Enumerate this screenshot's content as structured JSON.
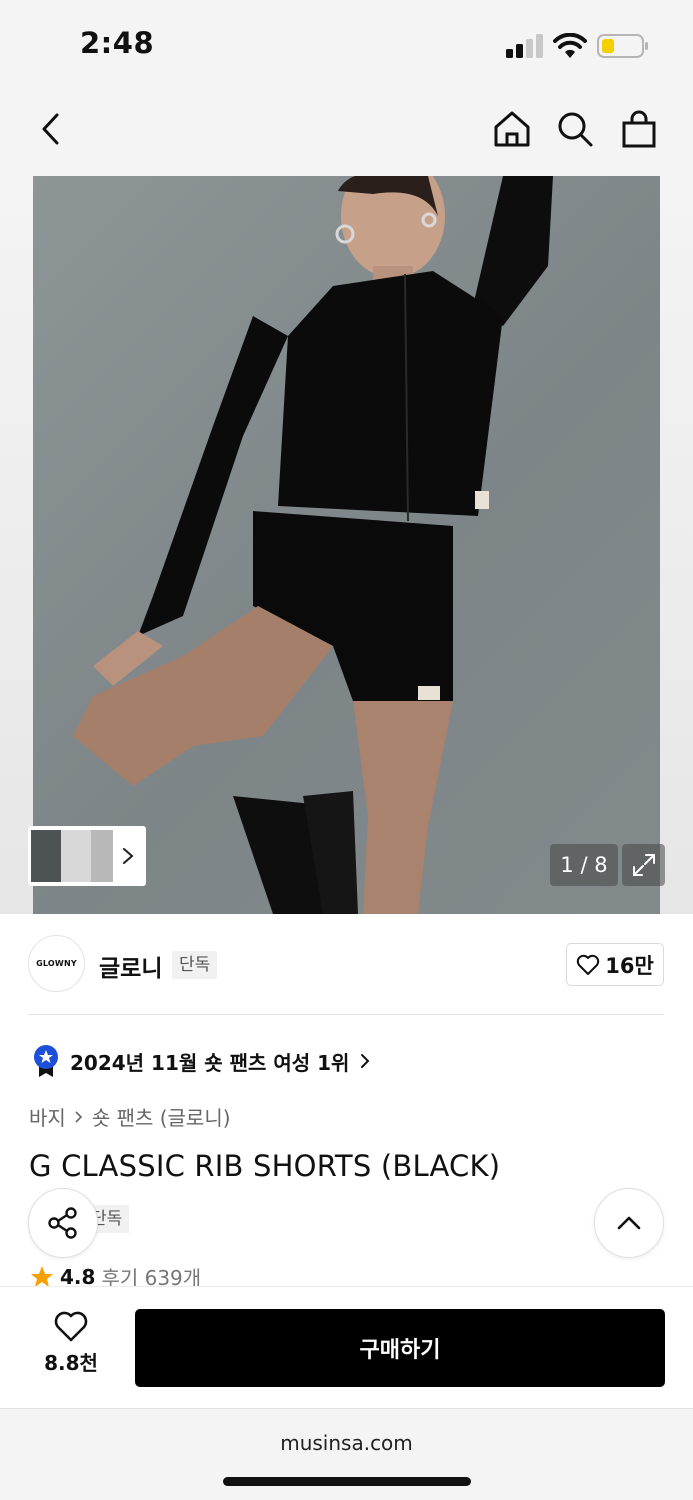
{
  "status_bar": {
    "time": "2:48",
    "battery_color": "#f5cf00"
  },
  "nav": {
    "back_icon": "chevron-left-icon",
    "home_icon": "home-icon",
    "search_icon": "search-icon",
    "cart_icon": "shopping-bag-icon"
  },
  "gallery": {
    "page_counter": "1 / 8",
    "current_page": 1,
    "total_pages": 8,
    "expand_icon": "expand-icon"
  },
  "brand": {
    "logo_text": "GLOWNY",
    "name": "글로니",
    "badge": "단독",
    "likes": "16만"
  },
  "ranking": {
    "text": "2024년 11월 숏 팬츠 여성 1위",
    "badge_color": "#1e4fd8"
  },
  "breadcrumb": {
    "category": "바지",
    "subcategory": "숏 팬츠 (글로니)"
  },
  "product": {
    "title": "G CLASSIC RIB SHORTS (BLACK)",
    "exclusive_badge": "단독",
    "rating": "4.8",
    "reviews": "후기 639개",
    "star_color": "#f5a100"
  },
  "bottom_bar": {
    "wish_count": "8.8천",
    "buy_label": "구매하기"
  },
  "browser": {
    "url": "musinsa.com"
  }
}
